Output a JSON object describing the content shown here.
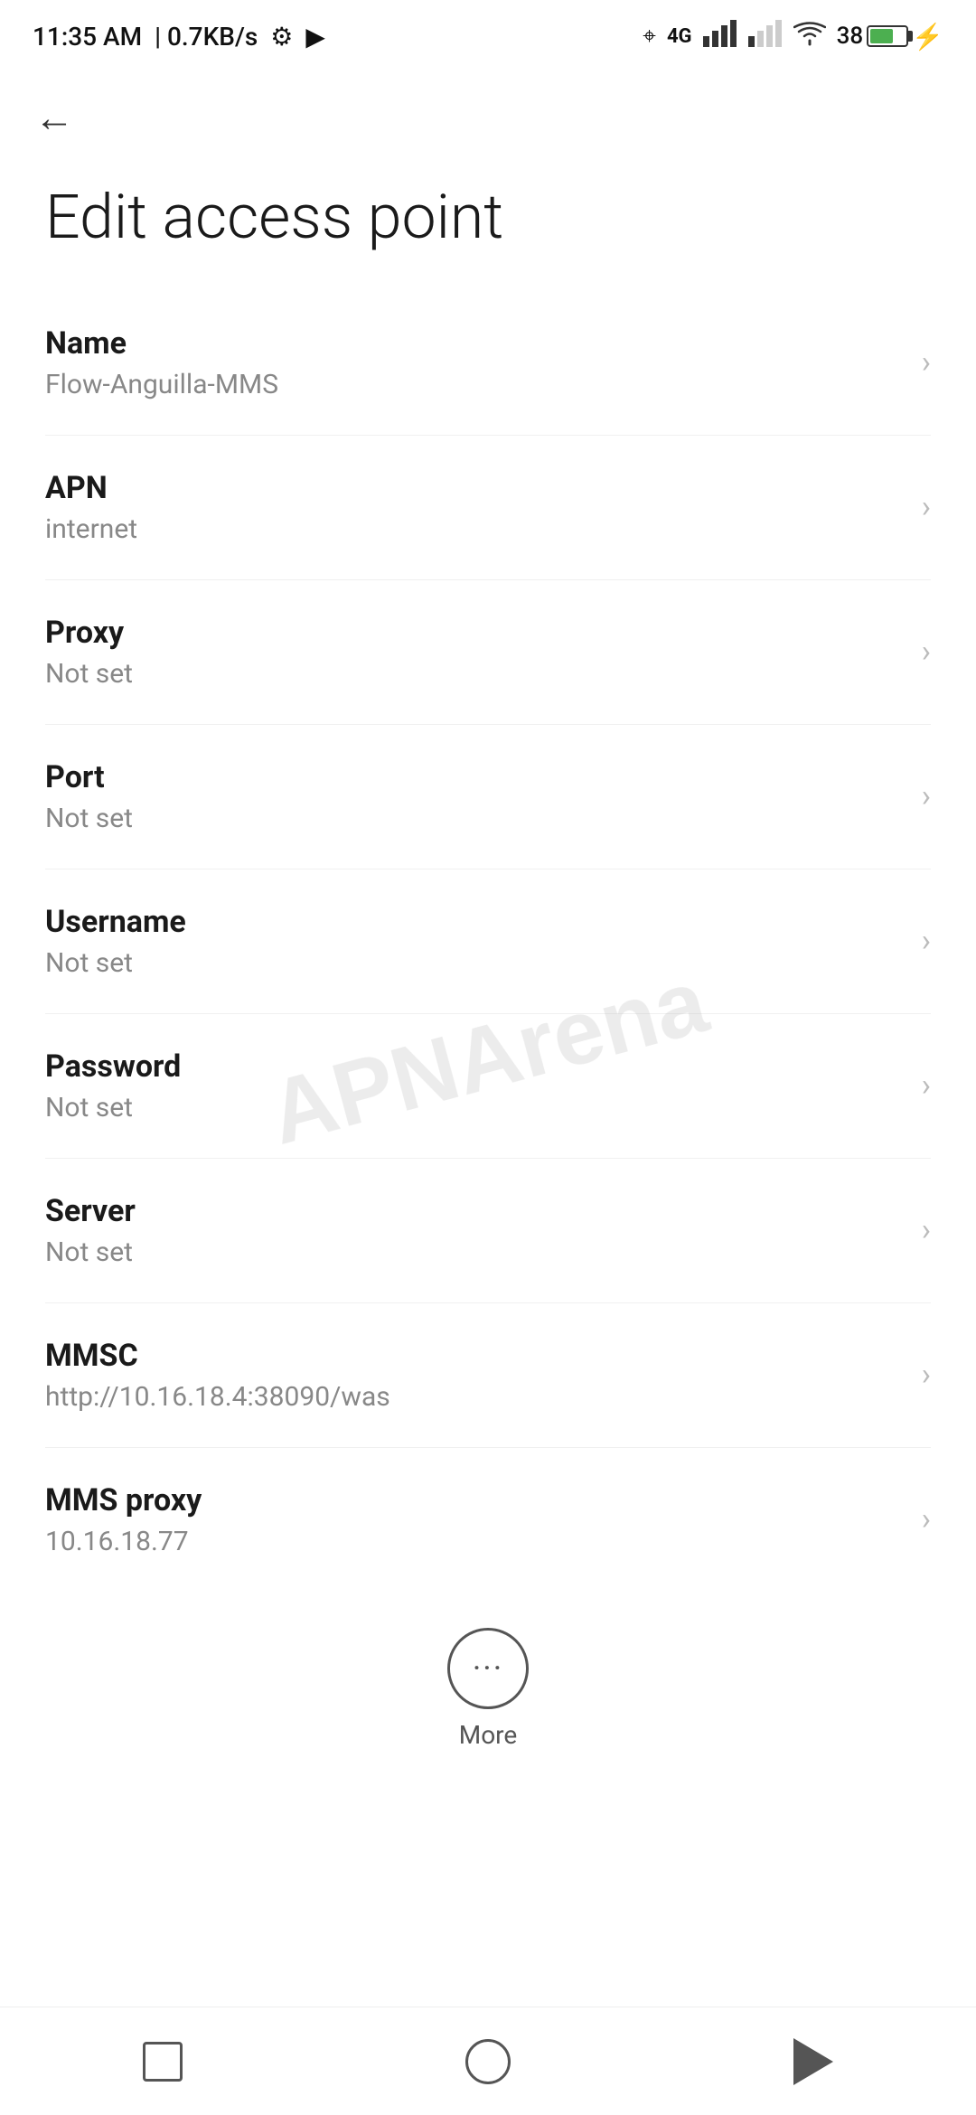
{
  "statusBar": {
    "time": "11:35 AM",
    "speed": "0.7KB/s"
  },
  "nav": {
    "backButton": "←"
  },
  "page": {
    "title": "Edit access point"
  },
  "settings": [
    {
      "label": "Name",
      "value": "Flow-Anguilla-MMS"
    },
    {
      "label": "APN",
      "value": "internet"
    },
    {
      "label": "Proxy",
      "value": "Not set"
    },
    {
      "label": "Port",
      "value": "Not set"
    },
    {
      "label": "Username",
      "value": "Not set"
    },
    {
      "label": "Password",
      "value": "Not set"
    },
    {
      "label": "Server",
      "value": "Not set"
    },
    {
      "label": "MMSC",
      "value": "http://10.16.18.4:38090/was"
    },
    {
      "label": "MMS proxy",
      "value": "10.16.18.77"
    }
  ],
  "more": {
    "label": "More"
  },
  "watermark": "APNArena"
}
